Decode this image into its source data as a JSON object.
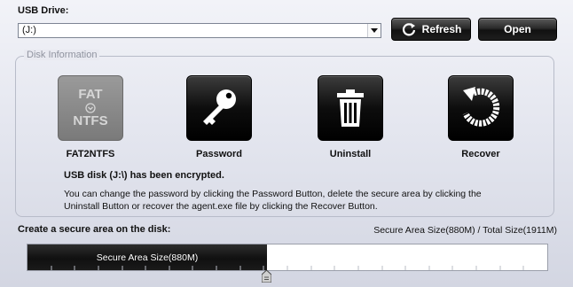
{
  "header": {
    "usb_label": "USB Drive:",
    "drive_value": "(J:)",
    "refresh_label": "Refresh",
    "open_label": "Open"
  },
  "disk_info": {
    "title": "Disk Information",
    "tools": [
      {
        "label": "FAT2NTFS",
        "icon": "fat-ntfs-convert-icon",
        "icon_text_top": "FAT",
        "icon_text_bottom": "NTFS",
        "enabled": false
      },
      {
        "label": "Password",
        "icon": "key-icon",
        "enabled": true
      },
      {
        "label": "Uninstall",
        "icon": "trash-icon",
        "enabled": true
      },
      {
        "label": "Recover",
        "icon": "recover-arrow-icon",
        "enabled": true
      }
    ],
    "status": "USB disk (J:\\) has been encrypted.",
    "description": "You can change the password by clicking the Password Button, delete the secure area by clicking the Uninstall Button or recover the agent.exe file by clicking the Recover Button."
  },
  "secure_area": {
    "title": "Create a secure area on the disk:",
    "size_info": "Secure Area Size(880M) / Total Size(1911M)",
    "slider_label": "Secure Area Size(880M)",
    "secure_mb": 880,
    "total_mb": 1911
  },
  "colors": {
    "button_dark": "#111111",
    "fill_dark": "#1a1a1a",
    "disabled_gray": "#7a7a7a"
  }
}
